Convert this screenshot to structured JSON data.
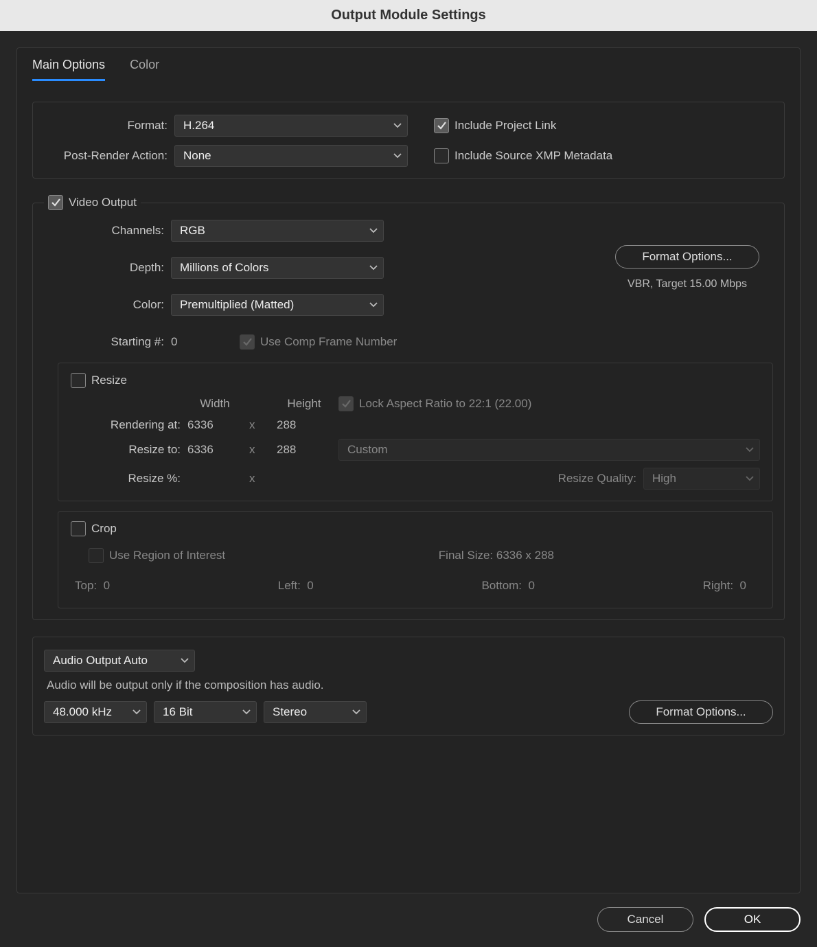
{
  "titlebar": "Output Module Settings",
  "tabs": {
    "main": "Main Options",
    "color": "Color"
  },
  "format": {
    "label": "Format:",
    "value": "H.264",
    "include_project_link_label": "Include Project Link",
    "include_project_link_checked": true,
    "post_render_label": "Post-Render Action:",
    "post_render_value": "None",
    "include_xmp_label": "Include Source XMP Metadata",
    "include_xmp_checked": false
  },
  "video": {
    "title": "Video Output",
    "checked": true,
    "channels_label": "Channels:",
    "channels_value": "RGB",
    "depth_label": "Depth:",
    "depth_value": "Millions of Colors",
    "color_label": "Color:",
    "color_value": "Premultiplied (Matted)",
    "starting_label": "Starting #:",
    "starting_value": "0",
    "use_comp_label": "Use Comp Frame Number",
    "format_options_btn": "Format Options...",
    "codec_info": "VBR, Target 15.00 Mbps"
  },
  "resize": {
    "title": "Resize",
    "checked": false,
    "width_hdr": "Width",
    "height_hdr": "Height",
    "lock_label": "Lock Aspect Ratio to 22:1 (22.00)",
    "lock_checked": true,
    "rendering_label": "Rendering at:",
    "rendering_w": "6336",
    "rendering_h": "288",
    "resize_to_label": "Resize to:",
    "resize_w": "6336",
    "resize_h": "288",
    "preset": "Custom",
    "resize_pct_label": "Resize %:",
    "x": "x",
    "quality_label": "Resize Quality:",
    "quality_value": "High"
  },
  "crop": {
    "title": "Crop",
    "checked": false,
    "roi_label": "Use Region of Interest",
    "roi_checked": false,
    "final_label": "Final Size: 6336 x 288",
    "top_label": "Top:",
    "top_v": "0",
    "left_label": "Left:",
    "left_v": "0",
    "bottom_label": "Bottom:",
    "bottom_v": "0",
    "right_label": "Right:",
    "right_v": "0"
  },
  "audio": {
    "mode": "Audio Output Auto",
    "hint": "Audio will be output only if the composition has audio.",
    "rate": "48.000 kHz",
    "depth": "16 Bit",
    "channels": "Stereo",
    "format_options_btn": "Format Options..."
  },
  "buttons": {
    "cancel": "Cancel",
    "ok": "OK"
  }
}
